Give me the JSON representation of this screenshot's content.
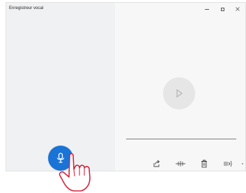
{
  "window": {
    "title": "Enregistreur vocal"
  },
  "window_controls": {
    "minimize_icon": "minimize-icon",
    "maximize_icon": "maximize-icon",
    "close_icon": "close-icon"
  },
  "player": {
    "play_icon": "play-icon"
  },
  "toolbar": {
    "share_icon": "share-icon",
    "trim_icon": "trim-icon",
    "delete_icon": "delete-icon",
    "mark_icon": "flag-icon",
    "more_icon": "more-icon"
  },
  "record": {
    "mic_icon": "microphone-icon",
    "accent_color": "#1a73d6"
  },
  "overlay": {
    "cursor_icon": "hand-pointer-icon"
  }
}
